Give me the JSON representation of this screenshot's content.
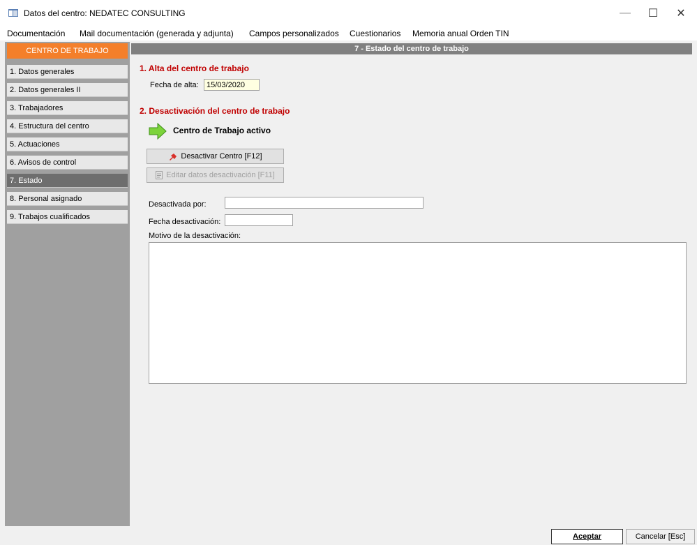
{
  "window": {
    "title": "Datos del centro: NEDATEC CONSULTING",
    "minimize": "—",
    "maximize": "☐",
    "close": "✕"
  },
  "menu": {
    "items": [
      "Documentación",
      "Mail documentación (generada y adjunta)",
      "Campos personalizados",
      "Cuestionarios",
      "Memoria anual Orden TIN"
    ]
  },
  "sidebar": {
    "header": "CENTRO DE TRABAJO",
    "items": [
      "1. Datos generales",
      "2. Datos generales II",
      "3. Trabajadores",
      "4. Estructura del centro",
      "5. Actuaciones",
      "6. Avisos de control",
      "7. Estado",
      "8. Personal asignado",
      "9. Trabajos cualificados"
    ],
    "active_index": 6,
    "header_color": "#f47f2a"
  },
  "content": {
    "header": "7 - Estado del centro de trabajo",
    "section1_title": "1. Alta del centro de trabajo",
    "fecha_alta_label": "Fecha de alta:",
    "fecha_alta_value": "15/03/2020",
    "section2_title": "2. Desactivación del centro de trabajo",
    "status_text": "Centro de Trabajo activo",
    "desactivar_button": "Desactivar Centro  [F12]",
    "editar_button": "Editar datos desactivación  [F11]",
    "desactivada_por_label": "Desactivada por:",
    "desactivada_por_value": "",
    "fecha_desactivacion_label": "Fecha desactivación:",
    "fecha_desactivacion_value": "",
    "motivo_label": "Motivo de la desactivación:",
    "motivo_value": "",
    "section_title_color": "#c00000"
  },
  "footer": {
    "accept_label": "Aceptar",
    "cancel_label": "Cancelar  [Esc]"
  }
}
